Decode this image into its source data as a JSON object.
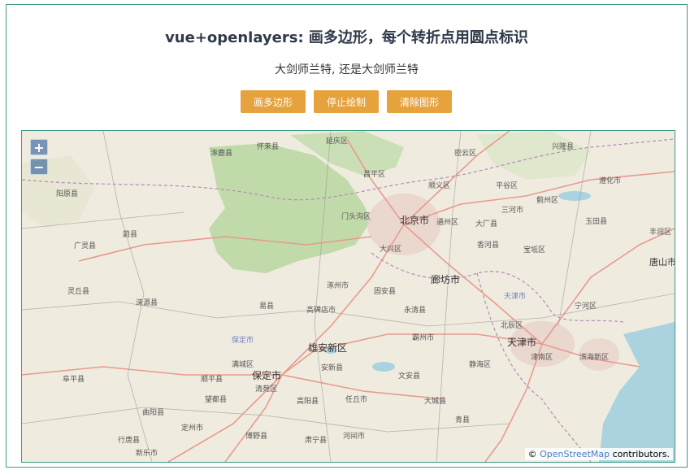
{
  "header": {
    "title": "vue+openlayers: 画多边形，每个转折点用圆点标识",
    "subtitle": "大剑师兰特, 还是大剑师兰特"
  },
  "toolbar": {
    "draw_label": "画多边形",
    "stop_label": "停止绘制",
    "clear_label": "清除图形"
  },
  "map": {
    "zoom_in": "+",
    "zoom_out": "−",
    "attribution_prefix": "©",
    "attribution_link": "OpenStreetMap",
    "attribution_suffix": "contributors.",
    "places": [
      "北京市",
      "通州区",
      "大兴区",
      "廊坊市",
      "天津市",
      "保定市",
      "雄安新区",
      "唐山市",
      "门头沟区",
      "昌平区",
      "顺义区",
      "密云区",
      "平谷区",
      "蓟州区",
      "玉田县",
      "香河县",
      "宝坻区",
      "武清区",
      "北辰区",
      "津南区",
      "滨海新区",
      "宁河区",
      "涿州市",
      "固安县",
      "永清县",
      "霸州市",
      "文安县",
      "静海区",
      "高碑店市",
      "易县",
      "涞源县",
      "阜平县",
      "顺平县",
      "望都县",
      "清苑区",
      "高阳县",
      "任丘市",
      "大城县",
      "曲阳县",
      "定州市",
      "行唐县",
      "新乐市",
      "博野县",
      "肃宁县",
      "河间市",
      "青县",
      "安新县",
      "满城区",
      "怀来县",
      "延庆区",
      "涿鹿县",
      "阳原县",
      "广灵县",
      "蔚县",
      "灵丘县",
      "兴隆县",
      "遵化市",
      "丰润区",
      "三河市",
      "大厂县",
      "保定市"
    ]
  }
}
